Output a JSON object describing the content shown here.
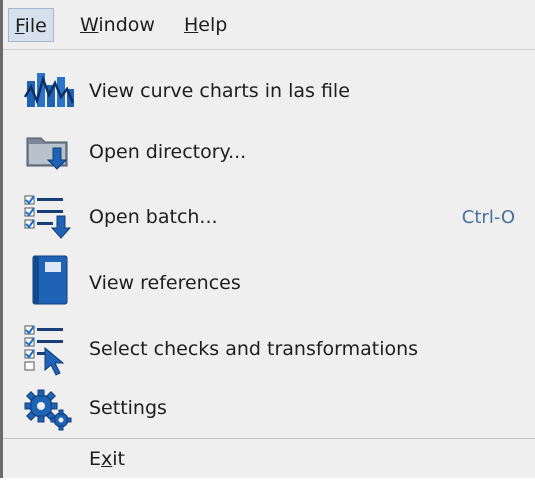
{
  "menubar": {
    "file": {
      "pre": "",
      "mn": "F",
      "post": "ile"
    },
    "window": {
      "pre": "",
      "mn": "W",
      "post": "indow"
    },
    "help": {
      "pre": "",
      "mn": "H",
      "post": "elp"
    }
  },
  "menu": {
    "items": [
      {
        "label": "View curve charts in las file",
        "icon": "curve-chart-icon"
      },
      {
        "label": "Open directory...",
        "icon": "open-directory-icon"
      },
      {
        "label": "Open batch...",
        "icon": "open-batch-icon",
        "accelerator": "Ctrl-O"
      },
      {
        "label": "View references",
        "icon": "book-icon"
      },
      {
        "label": "Select checks and transformations",
        "icon": "checklist-cursor-icon"
      },
      {
        "label": "Settings",
        "icon": "gears-icon"
      }
    ],
    "exit": {
      "pre": "E",
      "mn": "x",
      "post": "it"
    }
  },
  "colors": {
    "menu_bg": "#efefef",
    "active_title_bg": "#d7e1ee",
    "icon_blue": "#1f63b5",
    "accelerator": "#4b6f9b"
  }
}
